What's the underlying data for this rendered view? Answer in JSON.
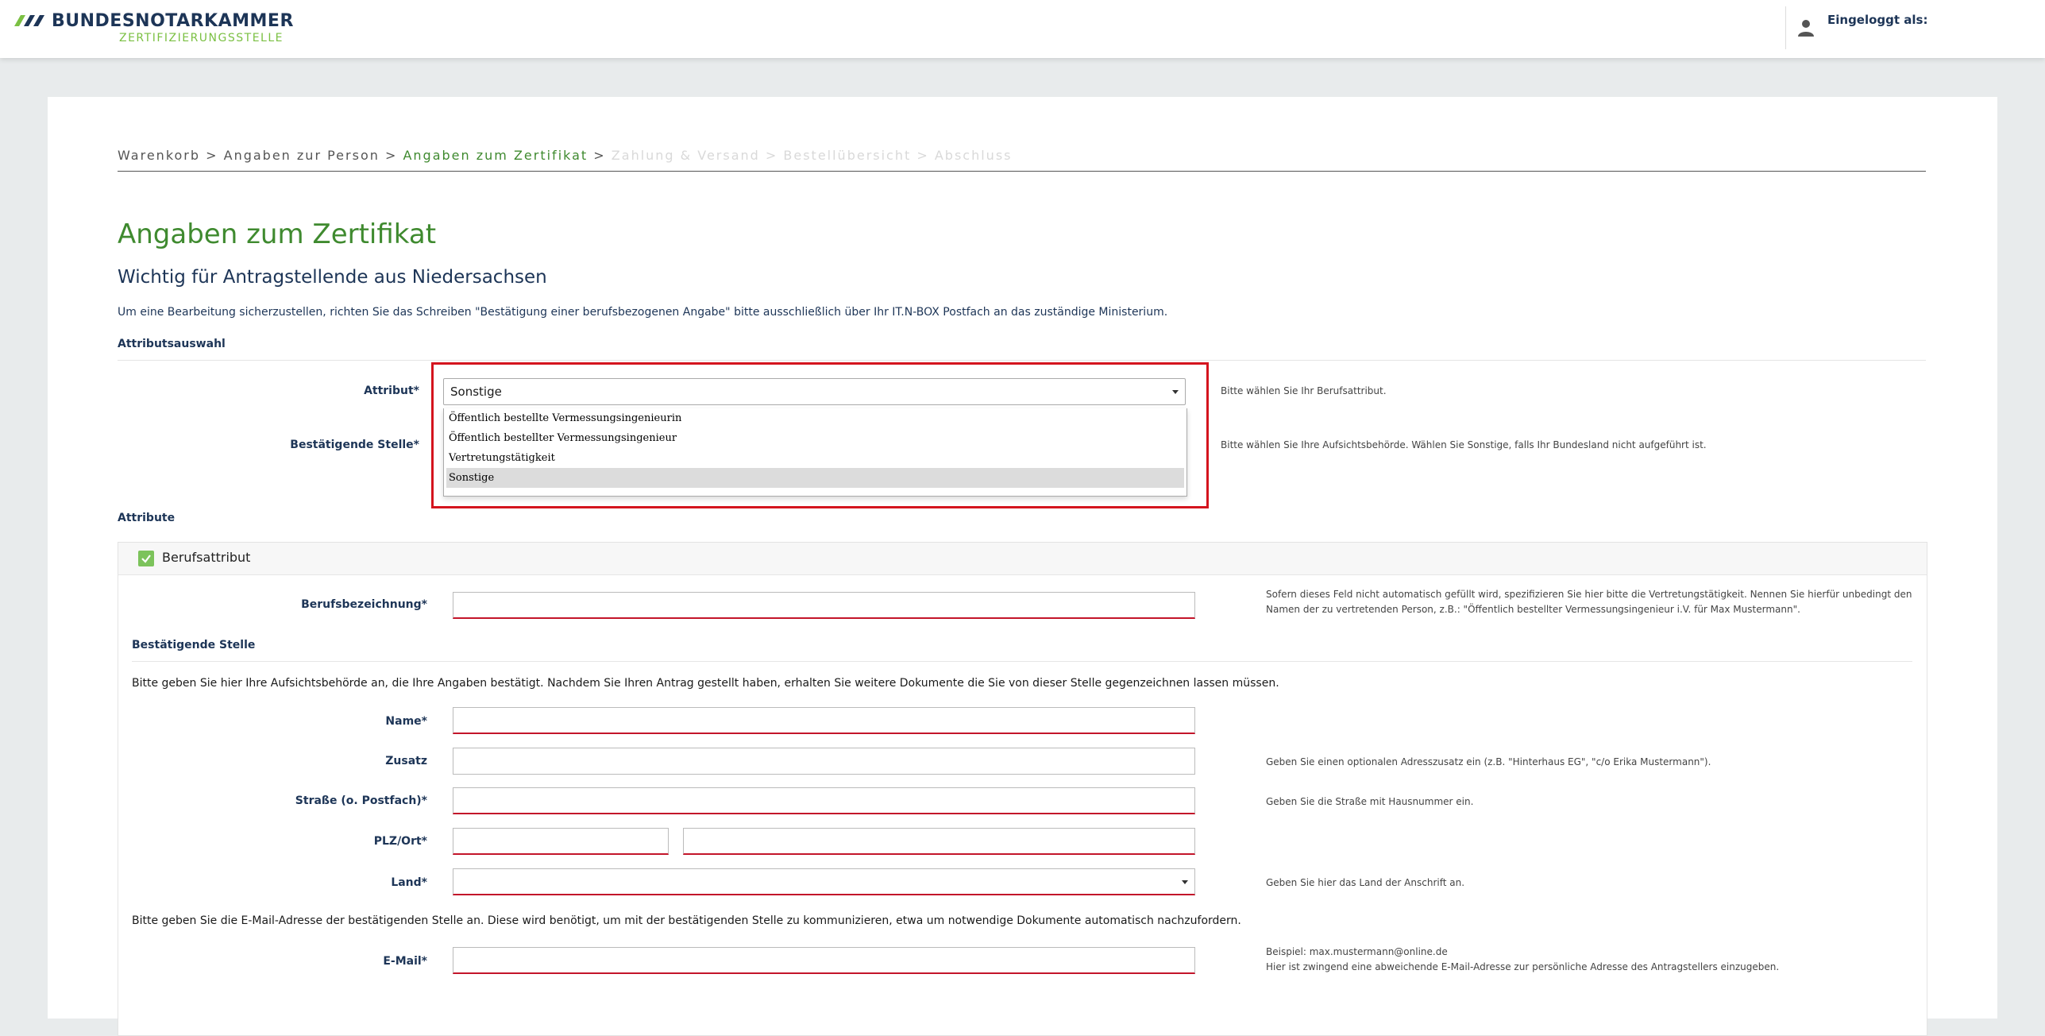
{
  "header": {
    "brand_name": "BUNDESNOTARKAMMER",
    "brand_sub": "ZERTIFIZIERUNGSSTELLE",
    "login_label": "Eingeloggt als:"
  },
  "breadcrumb": {
    "steps": [
      "Warenkorb",
      "Angaben zur Person",
      "Angaben zum Zertifikat",
      "Zahlung & Versand",
      "Bestellübersicht",
      "Abschluss"
    ],
    "separator": ">"
  },
  "page": {
    "title": "Angaben zum Zertifikat",
    "subtitle": "Wichtig für Antragstellende aus Niedersachsen",
    "info": "Um eine Bearbeitung sicherzustellen, richten Sie das Schreiben \"Bestätigung einer berufsbezogenen Angabe\" bitte ausschließlich über Ihr IT.N-BOX Postfach an das zuständige Ministerium."
  },
  "attribute_selection": {
    "heading": "Attributsauswahl",
    "attribute_label": "Attribut*",
    "attribute_value": "Sonstige",
    "attribute_hint": "Bitte wählen Sie Ihr Berufsattribut.",
    "authority_label": "Bestätigende Stelle*",
    "authority_hint": "Bitte wählen Sie Ihre Aufsichtsbehörde. Wählen Sie Sonstige, falls Ihr Bundesland nicht aufgeführt ist.",
    "options": [
      "Öffentlich bestellte Vermessungsingenieurin",
      "Öffentlich bestellter Vermessungsingenieur",
      "Vertretungstätigkeit",
      "Sonstige"
    ]
  },
  "attributes": {
    "heading": "Attribute",
    "panel_title": "Berufsattribut",
    "job_label": "Berufsbezeichnung*",
    "job_hint_1": "Sofern dieses Feld nicht automatisch gefüllt wird, spezifizieren Sie hier bitte die Vertretungstätigkeit. Nennen Sie hierfür unbedingt den",
    "job_hint_2": "Namen der zu vertretenden Person, z.B.: \"Öffentlich bestellter Vermessungsingenieur i.V. für Max Mustermann\".",
    "authority_heading": "Bestätigende Stelle",
    "authority_text": "Bitte geben Sie hier Ihre Aufsichtsbehörde an, die Ihre Angaben bestätigt. Nachdem Sie Ihren Antrag gestellt haben, erhalten Sie weitere Dokumente die Sie von dieser Stelle gegenzeichnen lassen müssen.",
    "name_label": "Name*",
    "zusatz_label": "Zusatz",
    "zusatz_hint": "Geben Sie einen optionalen Adresszusatz ein (z.B. \"Hinterhaus EG\", \"c/o Erika Mustermann\").",
    "street_label": "Straße (o. Postfach)*",
    "street_hint": "Geben Sie die Straße mit Hausnummer ein.",
    "plz_label": "PLZ/Ort*",
    "country_label": "Land*",
    "country_hint": "Geben Sie hier das Land der Anschrift an.",
    "email_text": "Bitte geben Sie die E-Mail-Adresse der bestätigenden Stelle an. Diese wird benötigt, um mit der bestätigenden Stelle zu kommunizieren, etwa um notwendige Dokumente automatisch nachzufordern.",
    "email_label": "E-Mail*",
    "email_hint_1": "Beispiel: max.mustermann@online.de",
    "email_hint_2": "Hier ist zwingend eine abweichende E-Mail-Adresse zur persönliche Adresse des Antragstellers einzugeben."
  },
  "colors": {
    "brand_navy": "#1d3557",
    "brand_green": "#3f8a2f",
    "error_red": "#c3152a",
    "highlight_red": "#d4141e"
  }
}
